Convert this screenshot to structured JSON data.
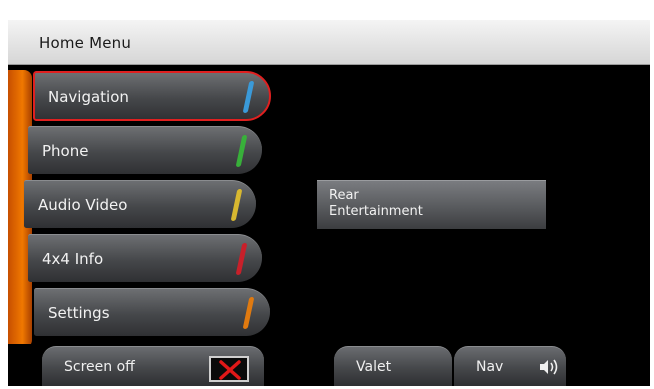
{
  "header": {
    "title": "Home Menu"
  },
  "menu": {
    "items": [
      {
        "label": "Navigation",
        "accent": "#3a9ad9",
        "selected": true
      },
      {
        "label": "Phone",
        "accent": "#38b03a"
      },
      {
        "label": "Audio Video",
        "accent": "#d8b830"
      },
      {
        "label": "4x4 Info",
        "accent": "#c8202a"
      },
      {
        "label": "Settings",
        "accent": "#e07a10"
      }
    ]
  },
  "main": {
    "rear_entertainment_label": "Rear\nEntertainment"
  },
  "footer": {
    "screen_off_label": "Screen off",
    "valet_label": "Valet",
    "nav_label": "Nav"
  },
  "colors": {
    "selection_border": "#e02020",
    "side_strip": "#f07800",
    "close_icon": "#e01818"
  },
  "icons": {
    "close": "close-icon",
    "speaker": "speaker-icon"
  }
}
